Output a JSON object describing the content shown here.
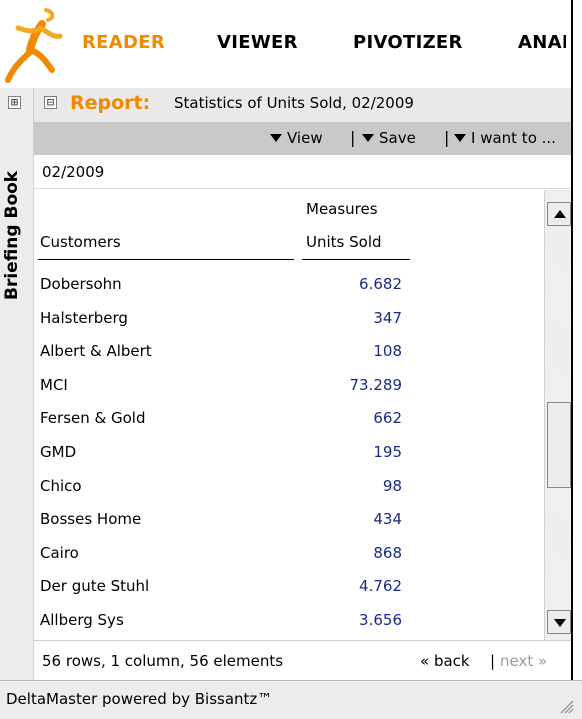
{
  "nav": {
    "items": [
      "READER",
      "VIEWER",
      "PIVOTIZER",
      "ANAL"
    ],
    "active_color": "#f08a00"
  },
  "sidebar": {
    "expander": "⊞",
    "label": "Briefing Book"
  },
  "report": {
    "collapse": "⊟",
    "label": "Report:",
    "title": "Statistics of Units Sold, 02/2009"
  },
  "toolbar": {
    "view": "View",
    "save": "Save",
    "want": "I want to ...",
    "separator": "|"
  },
  "filter": {
    "value": "02/2009"
  },
  "table": {
    "measures_header": "Measures",
    "row_header": "Customers",
    "column_header": "Units Sold",
    "rows": [
      {
        "customer": "Dobersohn",
        "units": "6.682"
      },
      {
        "customer": "Halsterberg",
        "units": "347"
      },
      {
        "customer": "Albert & Albert",
        "units": "108"
      },
      {
        "customer": "MCI",
        "units": "73.289"
      },
      {
        "customer": "Fersen & Gold",
        "units": "662"
      },
      {
        "customer": "GMD",
        "units": "195"
      },
      {
        "customer": "Chico",
        "units": "98"
      },
      {
        "customer": "Bosses Home",
        "units": "434"
      },
      {
        "customer": "Cairo",
        "units": "868"
      },
      {
        "customer": "Der gute Stuhl",
        "units": "4.762"
      },
      {
        "customer": "Allberg Sys",
        "units": "3.656"
      }
    ],
    "value_color": "#1a2a8a"
  },
  "footer": {
    "summary": "56 rows, 1 column, 56 elements",
    "back": "« back",
    "pipe": "|",
    "next": "next »"
  },
  "status": {
    "text": "DeltaMaster powered by Bissantz™"
  },
  "icons": [
    "runner-logo-icon",
    "plus-box-icon",
    "minus-box-icon",
    "dropdown-triangle-icon",
    "scroll-up-icon",
    "scroll-down-icon",
    "resize-grip-icon"
  ]
}
